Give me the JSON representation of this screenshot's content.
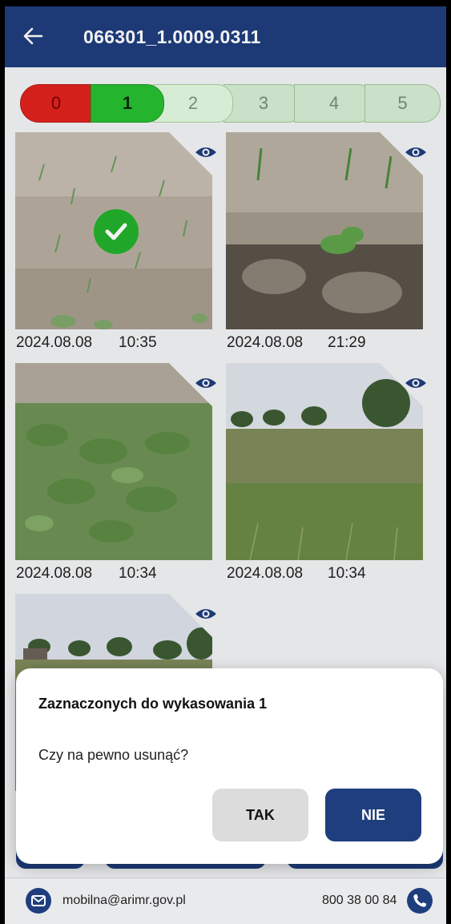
{
  "header": {
    "title": "066301_1.0009.0311"
  },
  "rating": {
    "options": [
      "0",
      "1",
      "2",
      "3",
      "4",
      "5"
    ],
    "selected": "1"
  },
  "photos": [
    {
      "date": "2024.08.08",
      "time": "10:35",
      "selected": true
    },
    {
      "date": "2024.08.08",
      "time": "21:29",
      "selected": false
    },
    {
      "date": "2024.08.08",
      "time": "10:34",
      "selected": false
    },
    {
      "date": "2024.08.08",
      "time": "10:34",
      "selected": false
    },
    {
      "date": "",
      "time": "",
      "selected": false
    }
  ],
  "dialog": {
    "title": "Zaznaczonych do wykasowania 1",
    "message": "Czy na pewno usunąć?",
    "confirm_label": "TAK",
    "cancel_label": "NIE"
  },
  "footer": {
    "email": "mobilna@arimr.gov.pl",
    "phone": "800 38 00 84"
  },
  "colors": {
    "primary": "#1f3e7e",
    "rating_0": "#e0231e",
    "rating_1": "#25b42e",
    "rating_inactive": "#d6ecd4"
  }
}
